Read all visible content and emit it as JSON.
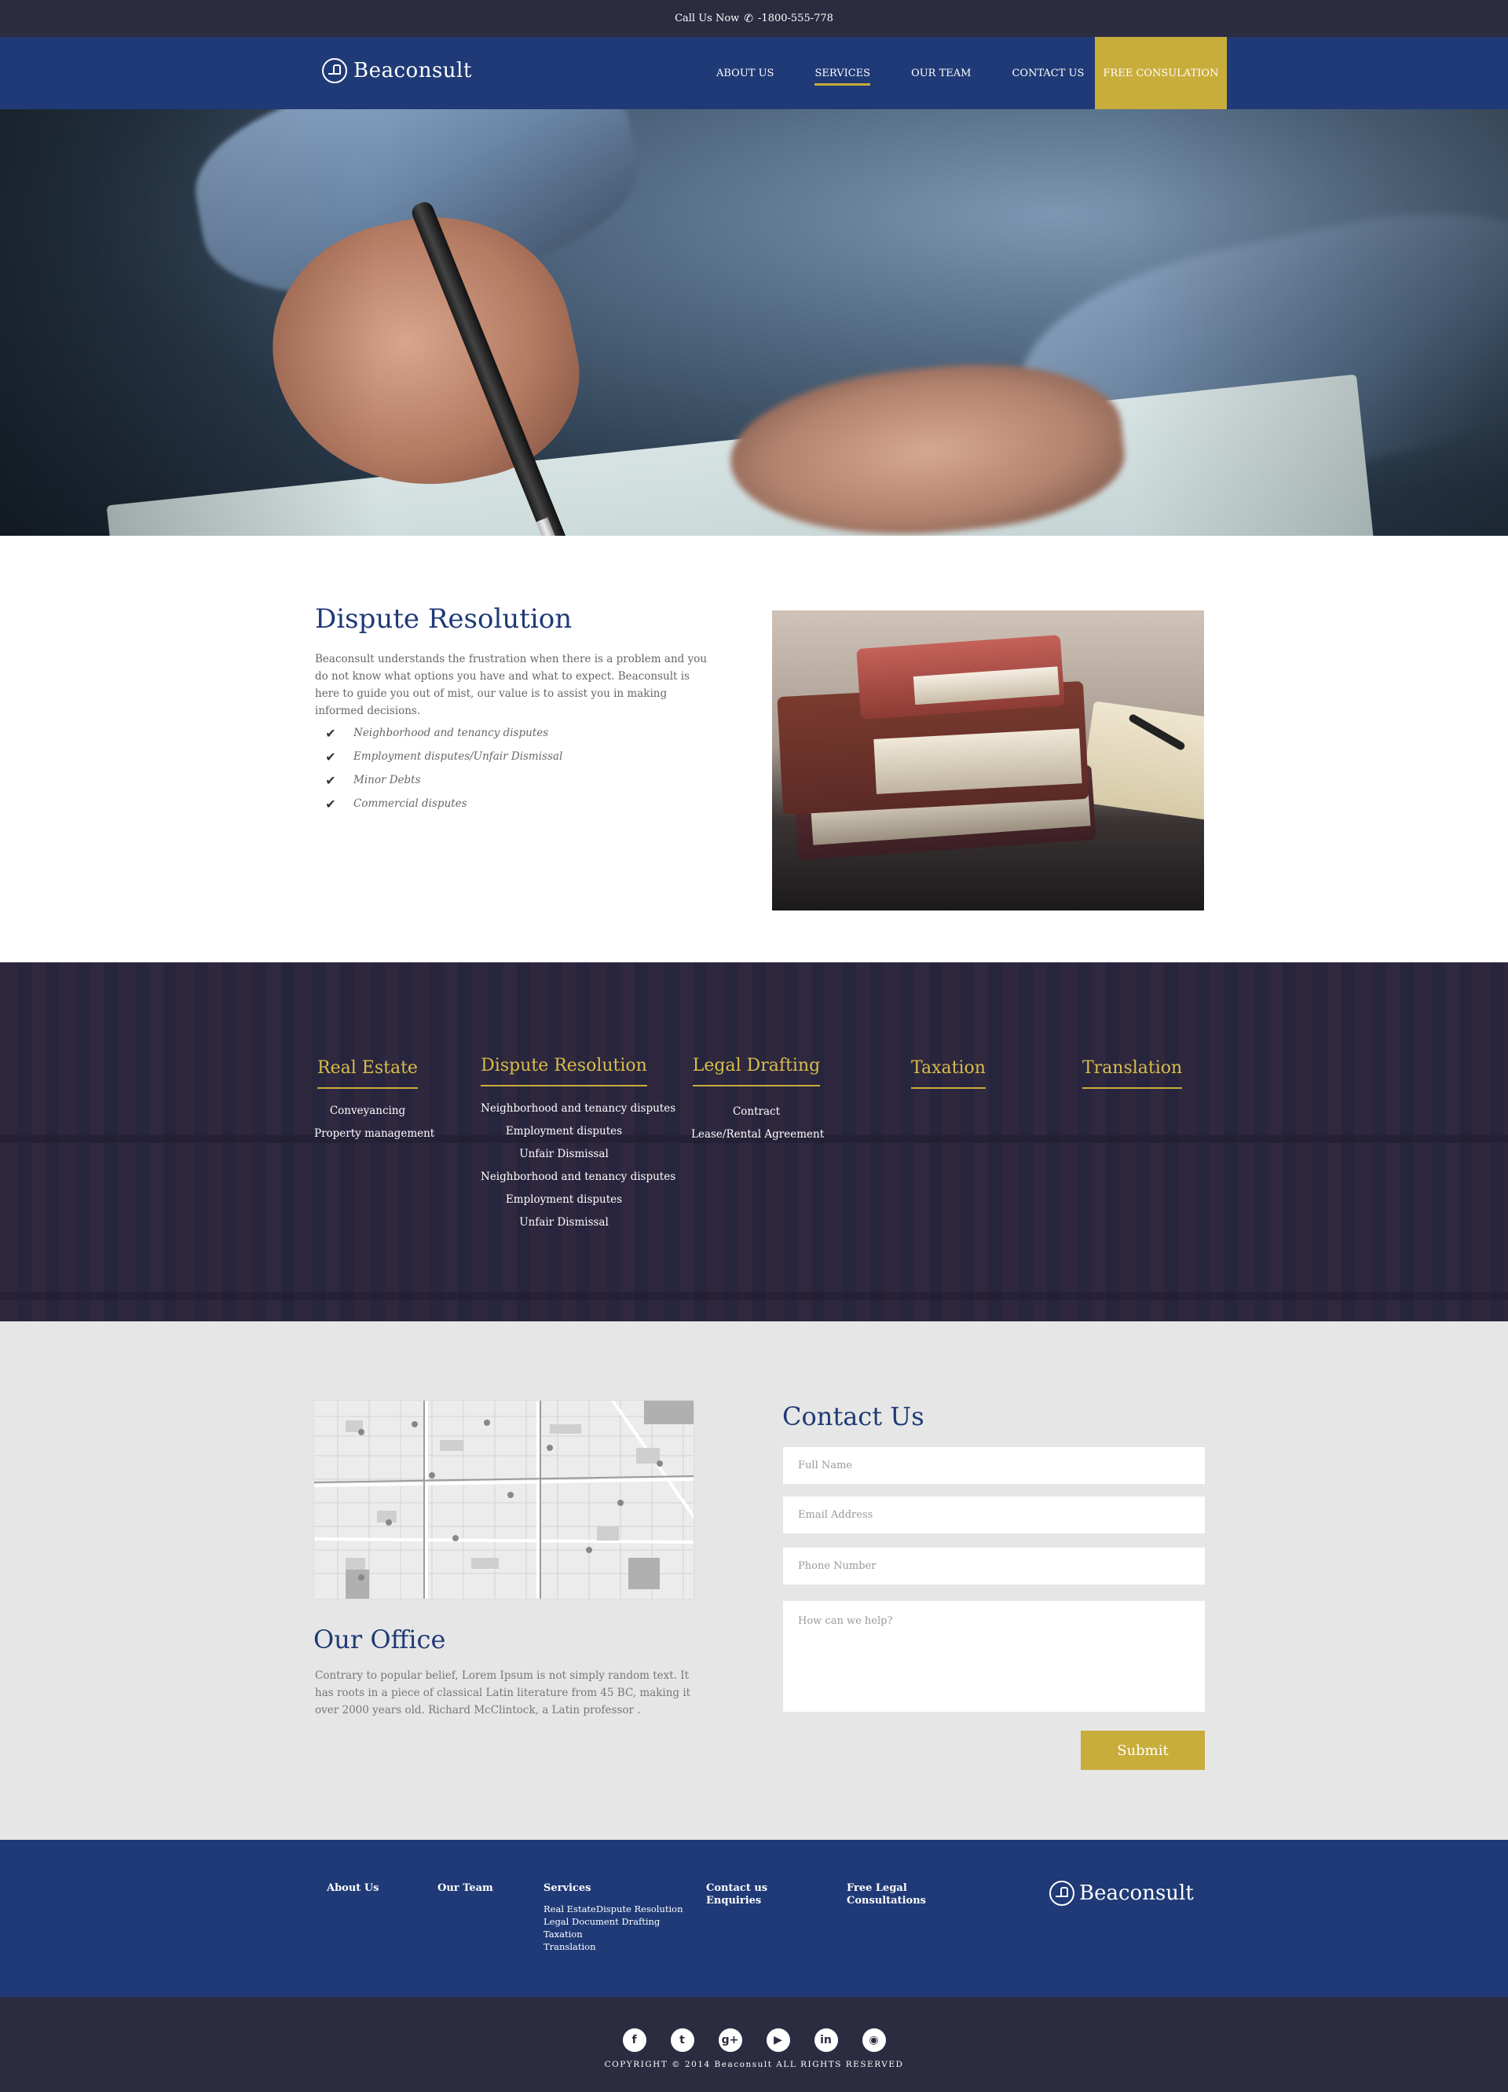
{
  "topbar": {
    "call_label": "Call Us Now",
    "phone": "-1800-555-778",
    "phone_icon": "phone-icon"
  },
  "brand": {
    "name": "Beaconsult"
  },
  "nav": {
    "links": [
      "ABOUT US",
      "SERVICES",
      "OUR TEAM",
      "CONTACT US"
    ],
    "active": "SERVICES",
    "cta": "FREE CONSULATION"
  },
  "dispute": {
    "title": "Dispute Resolution",
    "intro": "Beaconsult understands the frustration when there is a problem and you do not know what options you have and what to expect. Beaconsult is here to guide you out of mist, our value is to assist you in making informed decisions.",
    "items": [
      "Neighborhood and tenancy disputes",
      "Employment disputes/Unfair Dismissal",
      "Minor Debts",
      "Commercial disputes"
    ]
  },
  "services": [
    {
      "title": "Real Estate",
      "items": [
        "Conveyancing",
        "Property management"
      ]
    },
    {
      "title": "Dispute Resolution",
      "items": [
        "Neighborhood and tenancy disputes",
        "Employment disputes",
        "Unfair Dismissal",
        "Neighborhood and tenancy disputes",
        "Employment disputes",
        "Unfair Dismissal"
      ]
    },
    {
      "title": "Legal Drafting",
      "items": [
        "Contract",
        "Lease/Rental Agreement"
      ]
    },
    {
      "title": "Taxation",
      "items": []
    },
    {
      "title": "Translation",
      "items": []
    }
  ],
  "office": {
    "title": "Our Office",
    "text": "Contrary to popular belief, Lorem Ipsum is not simply random text. It has roots in a piece of classical Latin literature from 45 BC, making it over 2000 years old. Richard McClintock, a Latin professor ."
  },
  "contact": {
    "title": "Contact Us",
    "placeholders": {
      "name": "Full Name",
      "email": "Email Address",
      "phone": "Phone Number",
      "message": "How can we help?"
    },
    "submit": "Submit"
  },
  "footer": {
    "about": "About Us",
    "team": "Our Team",
    "services": "Services",
    "services_sub": [
      "Real EstateDispute Resolution",
      "Legal Document Drafting",
      "Taxation",
      "Translation"
    ],
    "contact_line1": "Contact us",
    "contact_line2": "Enquiries",
    "free_line1": "Free Legal",
    "free_line2": "Consultations"
  },
  "social_icons": [
    "facebook-icon",
    "twitter-icon",
    "google-plus-icon",
    "youtube-icon",
    "linkedin-icon",
    "instagram-icon"
  ],
  "copyright": "COPYRIGHT © 2014 Beaconsult ALL RIGHTS RESERVED",
  "colors": {
    "navy": "#1f3a76",
    "dark": "#2b2c40",
    "gold": "#c9ad3b",
    "light_gray": "#e6e6e6"
  }
}
